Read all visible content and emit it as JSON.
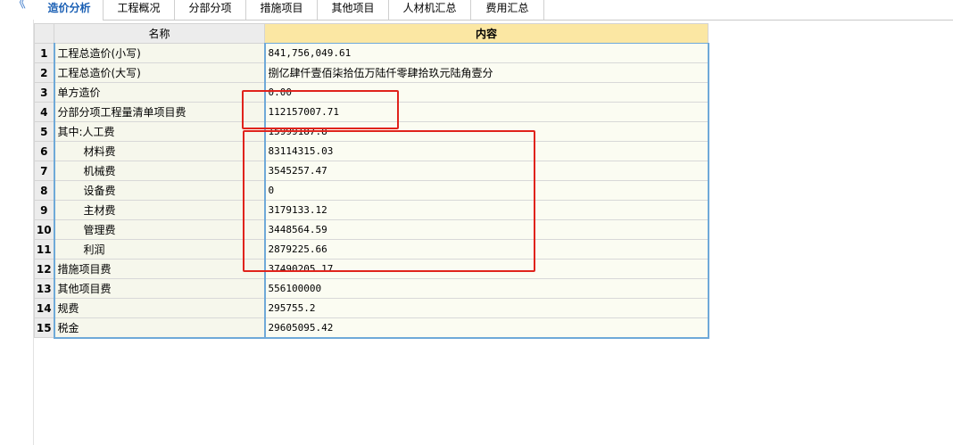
{
  "tabs": [
    {
      "label": "造价分析",
      "active": true
    },
    {
      "label": "工程概况",
      "active": false
    },
    {
      "label": "分部分项",
      "active": false
    },
    {
      "label": "措施项目",
      "active": false
    },
    {
      "label": "其他项目",
      "active": false
    },
    {
      "label": "人材机汇总",
      "active": false
    },
    {
      "label": "费用汇总",
      "active": false
    }
  ],
  "table": {
    "headers": {
      "name": "名称",
      "content": "内容"
    },
    "rows": [
      {
        "index": "1",
        "name": "工程总造价(小写)",
        "value": "841,756,049.61"
      },
      {
        "index": "2",
        "name": "工程总造价(大写)",
        "value": "捌亿肆仟壹佰柒拾伍万陆仟零肆拾玖元陆角壹分"
      },
      {
        "index": "3",
        "name": "单方造价",
        "value": "0.00"
      },
      {
        "index": "4",
        "name": "分部分项工程量清单项目费",
        "value": "112157007.71"
      },
      {
        "index": "5",
        "name": "其中:人工费",
        "value": "15999187.8"
      },
      {
        "index": "6",
        "name": "材料费",
        "value": "83114315.03"
      },
      {
        "index": "7",
        "name": "机械费",
        "value": "3545257.47"
      },
      {
        "index": "8",
        "name": "设备费",
        "value": "0"
      },
      {
        "index": "9",
        "name": "主材费",
        "value": "3179133.12"
      },
      {
        "index": "10",
        "name": "管理费",
        "value": "3448564.59"
      },
      {
        "index": "11",
        "name": "利润",
        "value": "2879225.66"
      },
      {
        "index": "12",
        "name": "措施项目费",
        "value": "37490205.17"
      },
      {
        "index": "13",
        "name": "其他项目费",
        "value": "556100000"
      },
      {
        "index": "14",
        "name": "规费",
        "value": "295755.2"
      },
      {
        "index": "15",
        "name": "税金",
        "value": "29605095.42"
      }
    ]
  },
  "icons": {
    "collapse": "double-chevron-left-icon"
  },
  "colors": {
    "accent": "#1a5fb4",
    "highlight_box": "#e0231c",
    "header_content_bg": "#fbe7a3",
    "grid_line": "#6fa9d8"
  }
}
